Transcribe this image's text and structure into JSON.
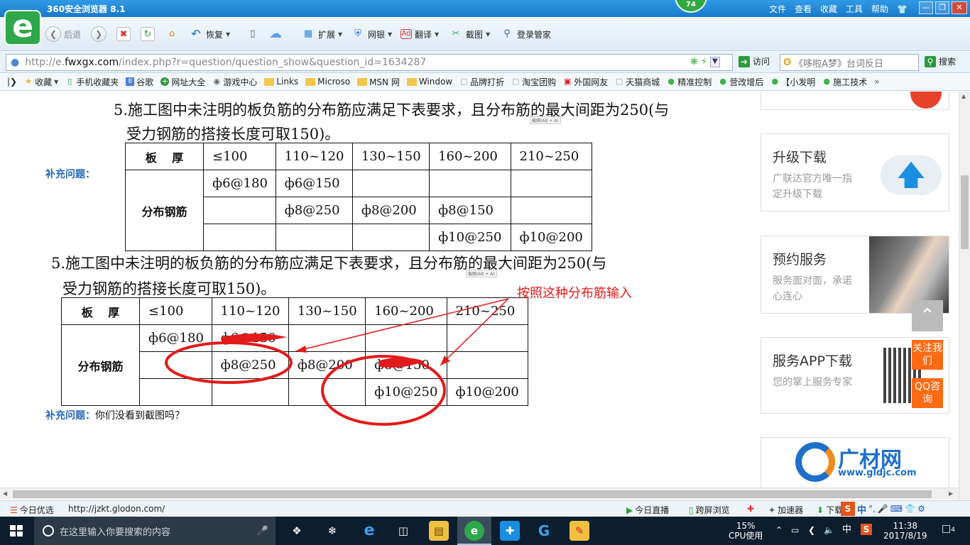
{
  "browser": {
    "title": "360安全浏览器 8.1",
    "logo_glyph": "e",
    "badge": "74",
    "menu": [
      "文件",
      "查看",
      "收藏",
      "工具",
      "帮助"
    ],
    "win_buttons": [
      "—",
      "❐",
      "✕"
    ]
  },
  "toolbar": {
    "back_label": "后退",
    "restore_label": "恢复",
    "extensions_label": "扩展",
    "netbank_label": "网银",
    "translate_label": "翻译",
    "screenshot_label": "截图",
    "login_manager_label": "登录管家"
  },
  "address": {
    "url_prefix": "http://e.",
    "url_host": "fwxgx.com",
    "url_rest": "/index.php?r=question/question_show&question_id=1634287",
    "visit_label": "访问",
    "search_placeholder": "《哆啦A梦》台词反日",
    "search_button": "搜索"
  },
  "bookmarks": [
    "收藏",
    "手机收藏夹",
    "谷歌",
    "网址大全",
    "游戏中心",
    "Links",
    "Microso",
    "MSN 网",
    "Window",
    "品牌打折",
    "淘宝团购",
    "外国网友",
    "天猫商城",
    "精准控制",
    "营改增后",
    "【小发明",
    "施工技术"
  ],
  "content": {
    "line1a": "5.施工图中未注明的板负筋的分布筋应满足下表要求，且分布筋的最大间距为250(与",
    "line1b": "受力钢筋的搭接长度可取150)。",
    "capture_hint": "截图(Alt + A)",
    "supplement_label": "补充问题：",
    "table_header": [
      "板　 厚",
      "≤100",
      "110~120",
      "130~150",
      "160~200",
      "210~250"
    ],
    "row_label": "分布钢筋",
    "rows": [
      [
        "ф6@180",
        "ф6@150",
        "",
        "",
        ""
      ],
      [
        "",
        "ф8@250",
        "ф8@200",
        "ф8@150",
        ""
      ],
      [
        "",
        "",
        "",
        "ф10@250",
        "ф10@200"
      ]
    ],
    "rows2": [
      [
        "ф6@180",
        "ф6@150",
        "",
        "",
        ""
      ],
      [
        "",
        "ф8@250",
        "ф8@200",
        "ф8@150",
        ""
      ],
      [
        "",
        "",
        "",
        "ф10@250",
        "ф10@200"
      ]
    ],
    "annotation": "按照这种分布筋输入",
    "supplement_question": "你们没看到截图吗？"
  },
  "sidebar": {
    "cards": [
      {
        "title": "升级下载",
        "desc": "广联达官方唯一指定升级下载"
      },
      {
        "title": "预约服务",
        "desc": "服务面对面，承诺心连心"
      },
      {
        "title": "服务APP下载",
        "desc": "您的掌上服务专家"
      }
    ],
    "follow_label": "关注我们",
    "qq_label": "QQ咨询",
    "gldjc_name": "广材网",
    "gldjc_url": "www.gldjc.com"
  },
  "statusbar": {
    "today_pick": "今日优选",
    "link_url": "http://jzkt.glodon.com/",
    "live": "今日直播",
    "cross_screen": "跨屏浏览",
    "accelerator": "加速器",
    "download": "下载",
    "ime": "中"
  },
  "taskbar": {
    "search_placeholder": "在这里输入你要搜索的内容",
    "cpu_percent": "15%",
    "cpu_label": "CPU使用",
    "ime": "中",
    "time": "11:38",
    "date": "2017/8/19",
    "notification_count": "4"
  },
  "colors": {
    "annotation_red": "#e31a1a",
    "supplement_blue": "#2868b8",
    "side_orange": "#ff6a13"
  }
}
